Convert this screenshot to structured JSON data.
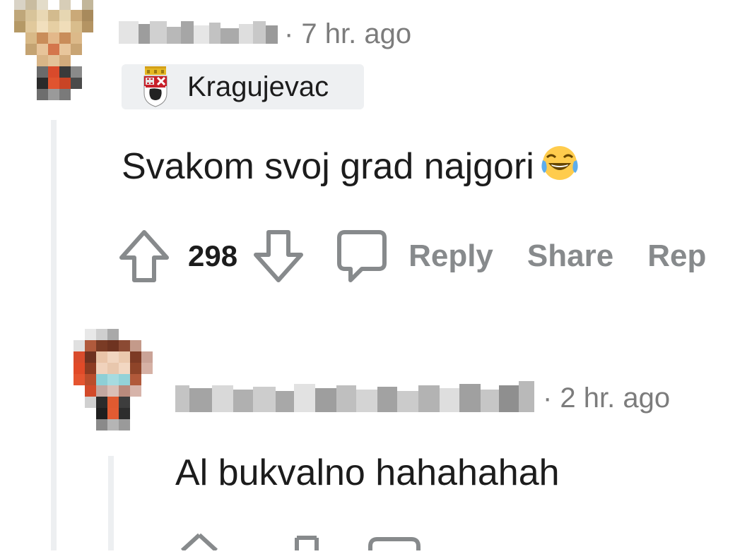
{
  "comment": {
    "timestamp": "· 7 hr. ago",
    "flair": "Kragujevac",
    "body": "Svakom svoj grad najgori",
    "emoji": "face-with-tears-of-joy",
    "votes": "298",
    "actions": {
      "reply": "Reply",
      "share": "Share",
      "report": "Rep"
    }
  },
  "reply_comment": {
    "timestamp": "· 2 hr. ago",
    "body": "Al bukvalno hahahahah"
  },
  "colors": {
    "muted_text": "#7c7c7c",
    "action_text": "#878a8c",
    "flair_bg": "#eef0f2",
    "thread_line": "#edeff1"
  }
}
